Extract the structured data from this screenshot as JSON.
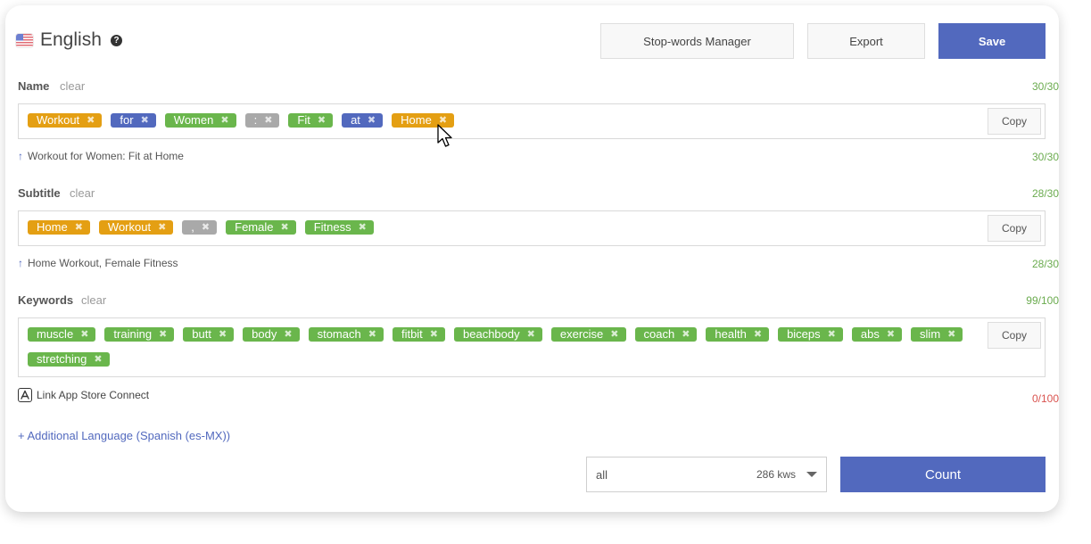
{
  "header": {
    "title": "English",
    "help": "?",
    "stopwords_label": "Stop-words Manager",
    "export_label": "Export",
    "save_label": "Save"
  },
  "name": {
    "label": "Name",
    "clear": "clear",
    "counter": "30/30",
    "tags": [
      {
        "text": "Workout",
        "color": "orange"
      },
      {
        "text": "for",
        "color": "blue"
      },
      {
        "text": "Women",
        "color": "green"
      },
      {
        "text": ":",
        "color": "gray"
      },
      {
        "text": "Fit",
        "color": "green"
      },
      {
        "text": "at",
        "color": "blue"
      },
      {
        "text": "Home",
        "color": "orange"
      }
    ],
    "copy": "Copy",
    "preview": "Workout for Women: Fit at Home",
    "preview_counter": "30/30"
  },
  "subtitle": {
    "label": "Subtitle",
    "clear": "clear",
    "counter": "28/30",
    "tags": [
      {
        "text": "Home",
        "color": "orange"
      },
      {
        "text": "Workout",
        "color": "orange"
      },
      {
        "text": ",",
        "color": "gray"
      },
      {
        "text": "Female",
        "color": "green"
      },
      {
        "text": "Fitness",
        "color": "green"
      }
    ],
    "copy": "Copy",
    "preview": "Home Workout, Female Fitness",
    "preview_counter": "28/30"
  },
  "keywords": {
    "label": "Keywords",
    "clear": "clear",
    "counter": "99/100",
    "tags": [
      {
        "text": "muscle",
        "color": "green"
      },
      {
        "text": "training",
        "color": "green"
      },
      {
        "text": "butt",
        "color": "green"
      },
      {
        "text": "body",
        "color": "green"
      },
      {
        "text": "stomach",
        "color": "green"
      },
      {
        "text": "fitbit",
        "color": "green"
      },
      {
        "text": "beachbody",
        "color": "green"
      },
      {
        "text": "exercise",
        "color": "green"
      },
      {
        "text": "coach",
        "color": "green"
      },
      {
        "text": "health",
        "color": "green"
      },
      {
        "text": "biceps",
        "color": "green"
      },
      {
        "text": "abs",
        "color": "green"
      },
      {
        "text": "slim",
        "color": "green"
      },
      {
        "text": "stretching",
        "color": "green"
      }
    ],
    "copy": "Copy",
    "app_store_link": "Link App Store Connect",
    "secondary_counter": "0/100"
  },
  "additional_language": "+ Additional Language (Spanish (es-MX))",
  "footer": {
    "filter_value": "all",
    "kws_count": "286 kws",
    "count_label": "Count"
  },
  "colors": {
    "accent": "#5269be",
    "orange": "#e49f13",
    "green": "#6ab64c",
    "gray": "#a9a9a9",
    "counter_ok": "#6aab4e",
    "counter_warn": "#d9534f"
  }
}
